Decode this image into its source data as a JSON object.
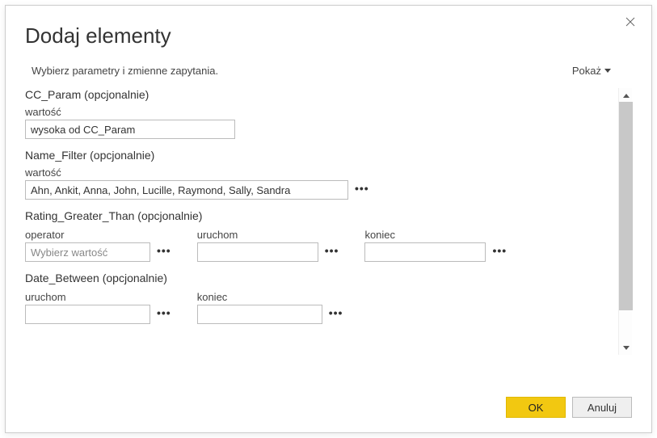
{
  "dialog": {
    "title": "Dodaj elementy",
    "subtitle": "Wybierz parametry i zmienne zapytania.",
    "show_label": "Pokaż"
  },
  "sections": {
    "cc_param": {
      "title": "CC_Param (opcjonalnie)",
      "value_label": "wartość",
      "value": "wysoka od CC_Param"
    },
    "name_filter": {
      "title": "Name_Filter (opcjonalnie)",
      "value_label": "wartość",
      "value": "Ahn, Ankit, Anna, John, Lucille, Raymond, Sally, Sandra"
    },
    "rating_greater_than": {
      "title": "Rating_Greater_Than (opcjonalnie)",
      "operator_label": "operator",
      "operator_placeholder": "Wybierz wartość",
      "start_label": "uruchom",
      "end_label": "koniec"
    },
    "date_between": {
      "title": "Date_Between (opcjonalnie)",
      "start_label": "uruchom",
      "end_label": "koniec"
    }
  },
  "buttons": {
    "ok": "OK",
    "cancel": "Anuluj"
  }
}
